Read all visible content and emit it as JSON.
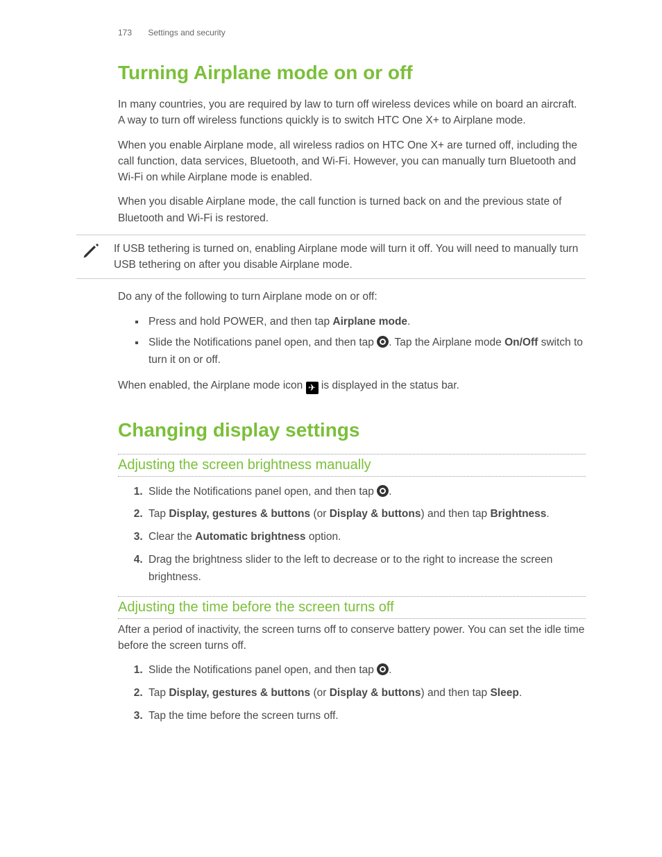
{
  "header": {
    "page_number": "173",
    "section": "Settings and security"
  },
  "airplane": {
    "title": "Turning Airplane mode on or off",
    "p1": "In many countries, you are required by law to turn off wireless devices while on board an aircraft. A way to turn off wireless functions quickly is to switch HTC One X+ to Airplane mode.",
    "p2": "When you enable Airplane mode, all wireless radios on HTC One X+ are turned off, including the call function, data services, Bluetooth, and Wi-Fi. However, you can manually turn Bluetooth and Wi-Fi on while Airplane mode is enabled.",
    "p3": "When you disable Airplane mode, the call function is turned back on and the previous state of Bluetooth and Wi-Fi is restored.",
    "note": "If USB tethering is turned on, enabling Airplane mode will turn it off. You will need to manually turn USB tethering on after you disable Airplane mode.",
    "p4": "Do any of the following to turn Airplane mode on or off:",
    "bullets": {
      "b1_pre": "Press and hold POWER, and then tap ",
      "b1_bold": "Airplane mode",
      "b1_post": ".",
      "b2_pre": "Slide the Notifications panel open, and then tap ",
      "b2_mid": ". Tap the Airplane mode ",
      "b2_onoff": "On/Off",
      "b2_post": " switch to turn it on or off."
    },
    "p5_pre": "When enabled, the Airplane mode icon ",
    "p5_post": " is displayed in the status bar."
  },
  "display": {
    "title": "Changing display settings",
    "brightness": {
      "heading": "Adjusting the screen brightness manually",
      "s1_pre": "Slide the Notifications panel open, and then tap ",
      "s1_post": ".",
      "s2_pre": "Tap ",
      "s2_b1": "Display, gestures & buttons",
      "s2_mid": " (or ",
      "s2_b2": "Display & buttons",
      "s2_mid2": ") and then tap ",
      "s2_b3": "Brightness",
      "s2_post": ".",
      "s3_pre": "Clear the ",
      "s3_b": "Automatic brightness",
      "s3_post": " option.",
      "s4": "Drag the brightness slider to the left to decrease or to the right to increase the screen brightness."
    },
    "sleep": {
      "heading": "Adjusting the time before the screen turns off",
      "intro": "After a period of inactivity, the screen turns off to conserve battery power. You can set the idle time before the screen turns off.",
      "s1_pre": "Slide the Notifications panel open, and then tap ",
      "s1_post": ".",
      "s2_pre": "Tap ",
      "s2_b1": "Display, gestures & buttons",
      "s2_mid": " (or ",
      "s2_b2": "Display & buttons",
      "s2_mid2": ") and then tap ",
      "s2_b3": "Sleep",
      "s2_post": ".",
      "s3": "Tap the time before the screen turns off."
    }
  }
}
